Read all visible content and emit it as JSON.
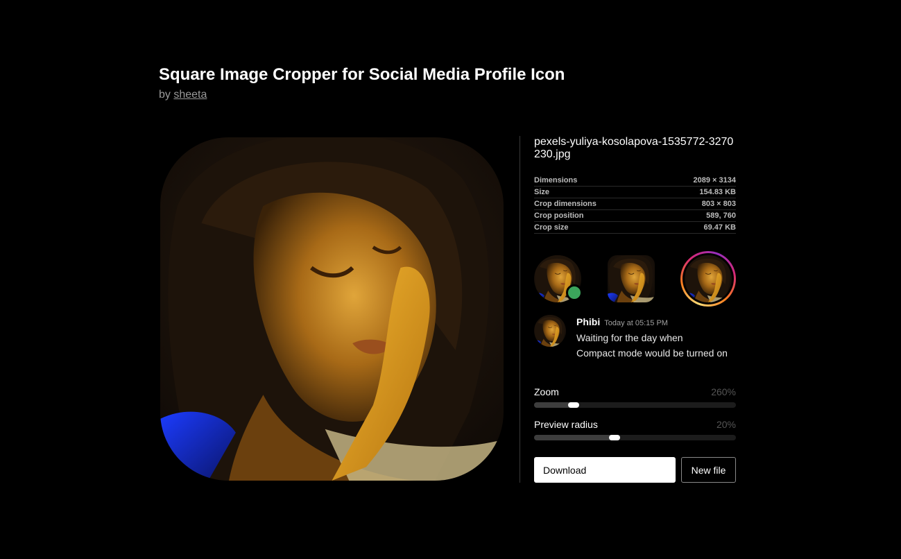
{
  "header": {
    "title": "Square Image Cropper for Social Media Profile Icon",
    "by_prefix": "by",
    "author": "sheeta"
  },
  "file": {
    "name": "pexels-yuliya-kosolapova-1535772-3270230.jpg"
  },
  "meta": [
    {
      "label": "Dimensions",
      "value": "2089 × 3134"
    },
    {
      "label": "Size",
      "value": "154.83 KB"
    },
    {
      "label": "Crop dimensions",
      "value": "803 × 803"
    },
    {
      "label": "Crop position",
      "value": "589, 760"
    },
    {
      "label": "Crop size",
      "value": "69.47 KB"
    }
  ],
  "chat": {
    "name": "Phibi",
    "time": "Today at 05:15 PM",
    "line1": "Waiting for the day when",
    "line2": "Compact mode would be turned on"
  },
  "zoom": {
    "label": "Zoom",
    "value": "260%",
    "fraction": 0.195
  },
  "radius": {
    "label": "Preview radius",
    "value": "20%",
    "fraction": 0.4
  },
  "buttons": {
    "download": "Download",
    "new_file": "New file"
  },
  "colors": {
    "status_online": "#3ba55c",
    "background": "#000000"
  }
}
